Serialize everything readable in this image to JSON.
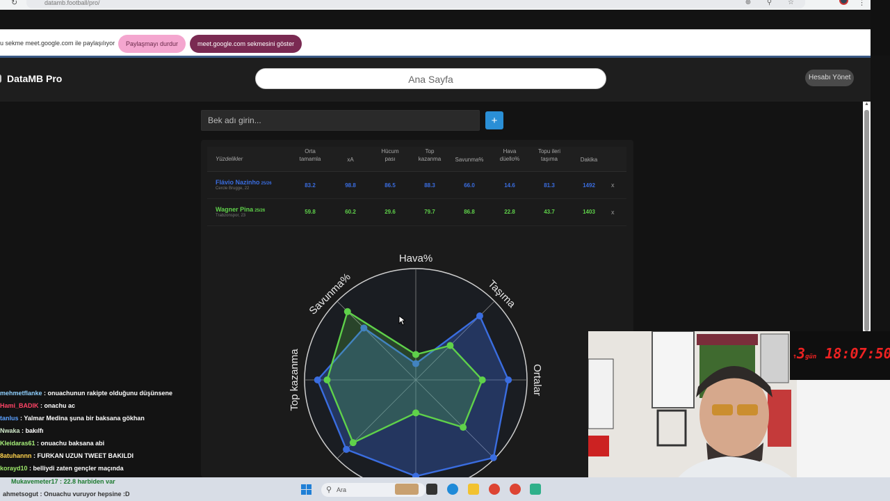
{
  "browser": {
    "url": "datamb.football/pro/",
    "share_message": "u sekme meet.google.com ile paylaşılıyor",
    "stop_sharing": "Paylaşmayı durdur",
    "show_tab": "meet.google.com sekmesini göster"
  },
  "app": {
    "brand": "DataMB Pro",
    "home": "Ana Sayfa",
    "account": "Hesabı Yönet",
    "player_placeholder": "Bek adı girin...",
    "add_label": "+"
  },
  "table": {
    "first_header": "Yüzdelikler",
    "headers": [
      [
        "Orta",
        "tamamla"
      ],
      [
        "xA",
        ""
      ],
      [
        "Hücum",
        "pası"
      ],
      [
        "Top",
        "kazanma"
      ],
      [
        "Savunma%",
        ""
      ],
      [
        "Hava",
        "düello%"
      ],
      [
        "Topu ileri",
        "taşıma"
      ],
      [
        "Dakika",
        ""
      ]
    ],
    "rows": [
      {
        "name": "Flávio Nazinho",
        "season": "25/26",
        "club": "Cercle Brugge, 22",
        "color": "#3a6de0",
        "values": [
          "83.2",
          "98.8",
          "86.5",
          "88.3",
          "66.0",
          "14.6",
          "81.3",
          "1492"
        ],
        "remove": "x"
      },
      {
        "name": "Wagner Pina",
        "season": "25/26",
        "club": "Trabzonspor, 23",
        "color": "#5fd14a",
        "values": [
          "59.8",
          "60.2",
          "29.6",
          "79.7",
          "86.8",
          "22.8",
          "43.7",
          "1403"
        ],
        "remove": "x"
      }
    ]
  },
  "chart_data": {
    "type": "radar",
    "axes": [
      "Hava%",
      "Taşıma",
      "Ortalar",
      "",
      "",
      "",
      "Top kazanma",
      "Savunma%"
    ],
    "series": [
      {
        "name": "Flávio Nazinho",
        "color": "#3a6de0",
        "values": [
          14.6,
          81.3,
          83.2,
          98.8,
          86.5,
          88.3,
          88.3,
          66.0
        ]
      },
      {
        "name": "Wagner Pina",
        "color": "#5fd14a",
        "values": [
          22.8,
          43.7,
          59.8,
          60.2,
          29.6,
          79.7,
          79.7,
          86.8
        ]
      }
    ],
    "range": [
      0,
      100
    ]
  },
  "chat": [
    {
      "user": "mehmetflanke",
      "color": "#8fd0ff",
      "text": "onuachunun rakipte olduğunu düşünsene"
    },
    {
      "user": "Hami_BADIK",
      "color": "#ff4466",
      "text": "onachu ac"
    },
    {
      "user": "tanlus",
      "color": "#5aa0ff",
      "text": "Yalmar Medina şuna bir baksana gökhan"
    },
    {
      "user": "Nwaka",
      "color": "#cfe8c9",
      "text": "bakılfı"
    },
    {
      "user": "Kleidaras61",
      "color": "#a7f07a",
      "text": "onuachu baksana abi"
    },
    {
      "user": "8atuhannn",
      "color": "#ffd34d",
      "text": "FURKAN UZUN TWEET BAKILDI"
    },
    {
      "user": "korayd10",
      "color": "#9eea6a",
      "text": "belliydi zaten gençler maçında"
    }
  ],
  "taskbar": {
    "search": "Ara",
    "overlay_chat_1": "Mukavemeter17 : 22.8 harbiden var",
    "overlay_chat_2": "ahmetsogut : Onuachu vuruyor hepsine :D"
  },
  "stream": {
    "timer_days": "3",
    "timer_days_label": "gün",
    "timer_time": "18:07:50"
  }
}
